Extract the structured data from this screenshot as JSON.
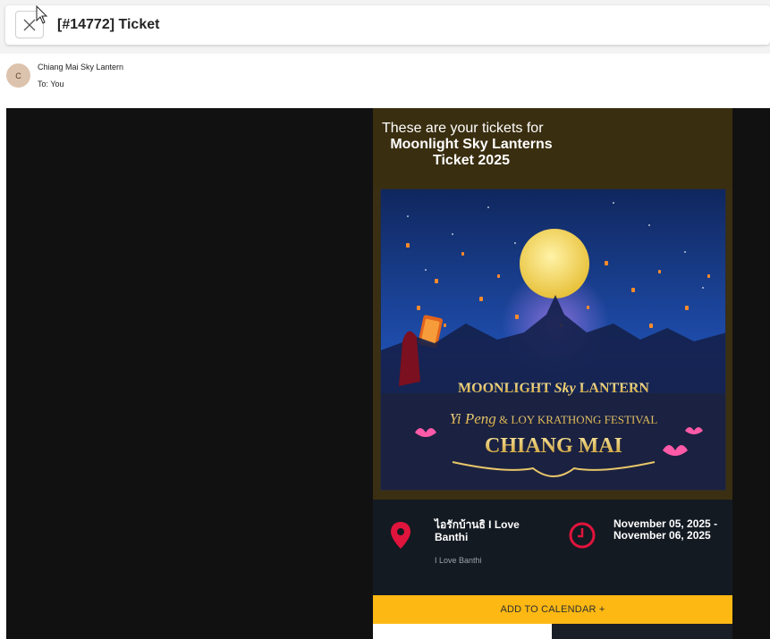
{
  "header": {
    "subject": "[#14772] Ticket",
    "close_icon": "close-icon"
  },
  "message": {
    "avatar_initial": "C",
    "sender_name": "Chiang Mai Sky Lantern",
    "to_label": "To:",
    "to_value": "You"
  },
  "ticket": {
    "intro": "These are your tickets for",
    "event_title": "Moonlight Sky Lanterns Ticket 2025",
    "poster": {
      "line1": "MOONLIGHT",
      "line1_script": "Sky",
      "line1_end": "LANTERN",
      "line2_script": "Yi Peng",
      "line2_amp": "&",
      "line2_rest": "LOY KRATHONG FESTIVAL",
      "line3": "CHIANG MAI"
    },
    "location_icon": "map-pin-icon",
    "location_name": "ไอรักบ้านธิ I Love Banthi",
    "location_sub": "I Love Banthi",
    "clock_icon": "clock-icon",
    "date_range": "November 05, 2025 - November 06, 2025",
    "calendar_button": "ADD TO CALENDAR +"
  },
  "colors": {
    "accent_yellow": "#fdb813",
    "pin_red": "#e0143c",
    "header_brown": "#3a2e10",
    "info_dark": "#141a22"
  }
}
